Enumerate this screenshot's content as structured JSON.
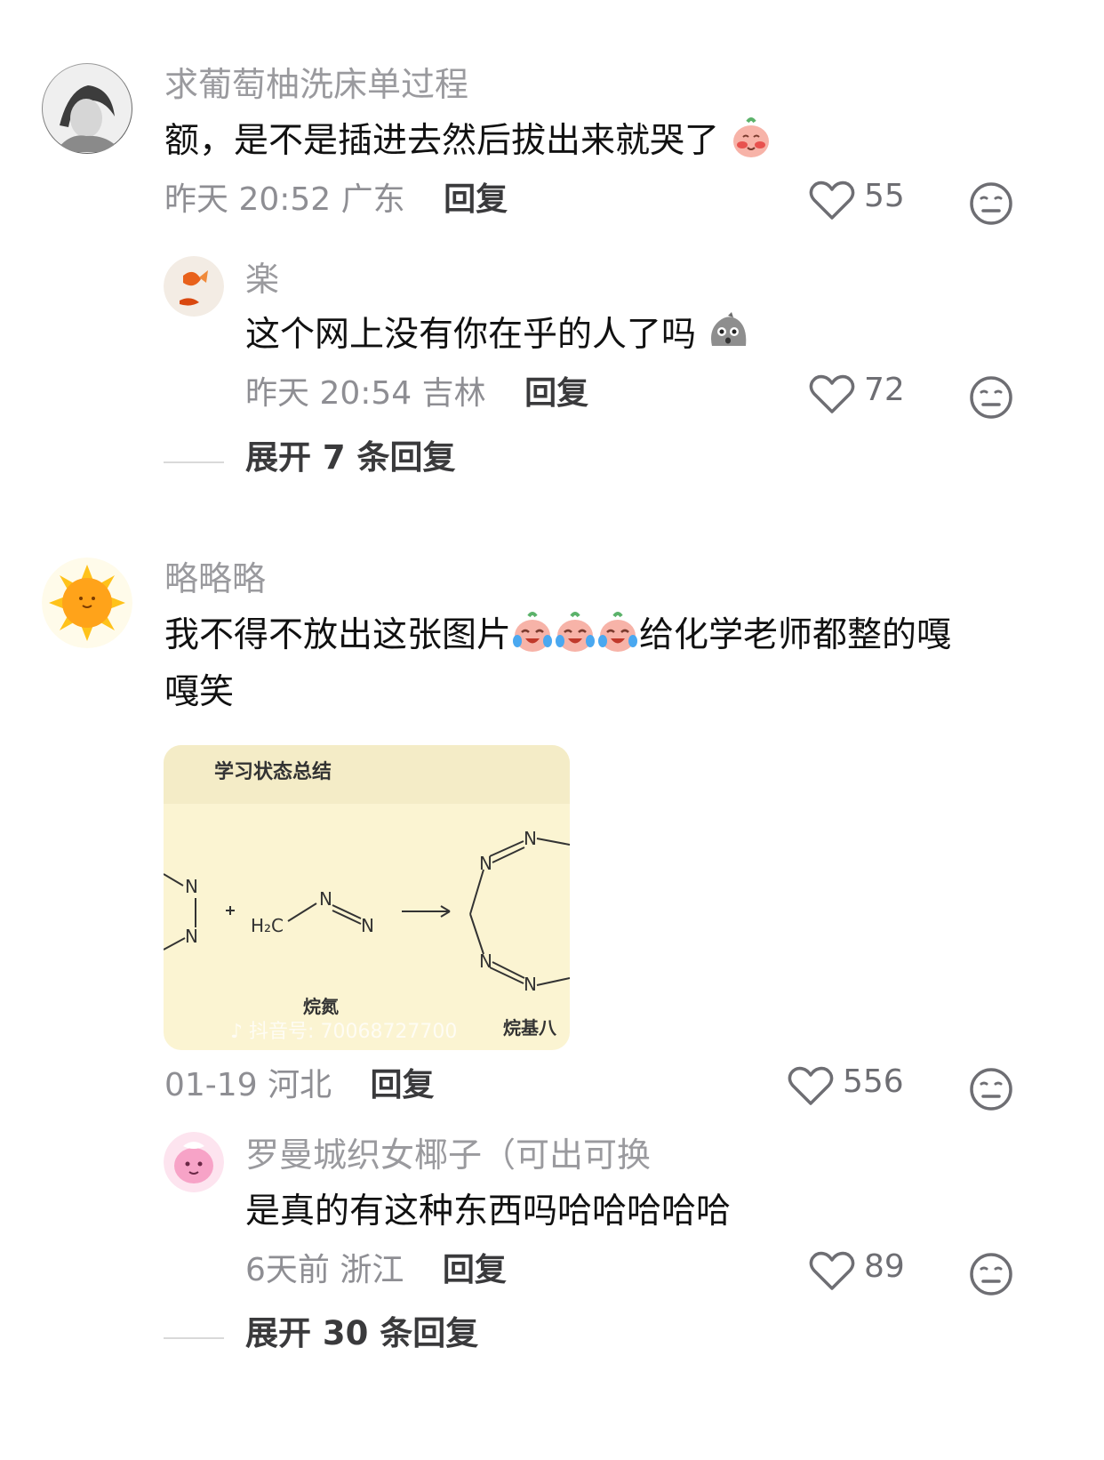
{
  "comments": [
    {
      "nickname": "求葡萄柚洗床单过程",
      "text": "额，是不是插进去然后拔出来就哭了",
      "time": "昨天 20:52",
      "location": "广东",
      "reply_label": "回复",
      "likes": "55",
      "emoji": "blush-peach-emoji",
      "replies": [
        {
          "nickname": "楽",
          "text": "这个网上没有你在乎的人了吗",
          "time": "昨天 20:54",
          "location": "吉林",
          "reply_label": "回复",
          "likes": "72",
          "emoji": "shocked-rock-emoji"
        }
      ],
      "expand_label": "展开 7 条回复"
    },
    {
      "nickname": "略略略",
      "text_line1": "我不得不放出这张图片",
      "text_after_emoji": "给化学老师都整的嘎",
      "text_line2": "嘎笑",
      "time": "01-19",
      "location": "河北",
      "reply_label": "回复",
      "likes": "556",
      "emoji": "crying-laughing-peach-emoji",
      "image": {
        "title": "学习状态总结",
        "label_left": "烷氮",
        "label_right": "烷基八",
        "watermark": "抖音号: 70068727700",
        "formula_h2c": "H₂C",
        "atom": "N"
      },
      "replies": [
        {
          "nickname": "罗曼城织女椰子（可出可换",
          "text": "是真的有这种东西吗哈哈哈哈哈",
          "time": "6天前",
          "location": "浙江",
          "reply_label": "回复",
          "likes": "89"
        }
      ],
      "expand_label": "展开 30 条回复"
    }
  ],
  "icons": {
    "like": "heart-outline-icon",
    "dislike": "neutral-face-icon"
  },
  "colors": {
    "image_bg": "#fbf4d2",
    "image_header": "#f4ecc7"
  }
}
